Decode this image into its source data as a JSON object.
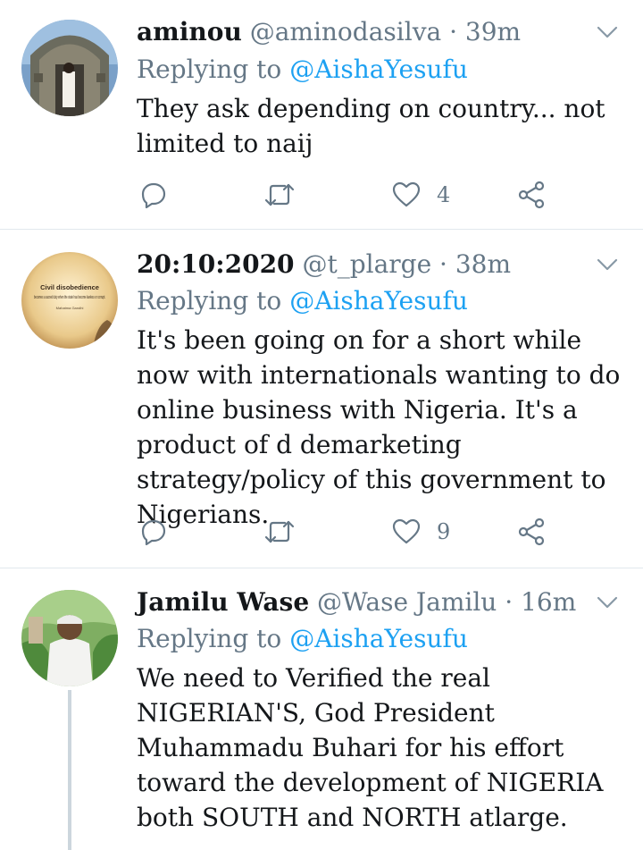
{
  "tweets": [
    {
      "name": "aminou",
      "handle": "@aminodasilva",
      "time": "39m",
      "replying_prefix": "Replying to",
      "replying_to": "@AishaYesufu",
      "text": "They ask depending on country... not limited to naij",
      "like_count": "4",
      "icons": [
        "reply-icon",
        "retweet-icon",
        "like-icon",
        "share-icon"
      ]
    },
    {
      "name": "20:10:2020",
      "handle": "@t_plarge",
      "time": "38m",
      "replying_prefix": "Replying to",
      "replying_to": "@AishaYesufu",
      "text": "It's been going on for a short while now with internationals wanting to do online business with Nigeria. It's a product of d demarketing strategy/policy of this government to Nigerians.",
      "like_count": "9",
      "avatar_text": {
        "title": "Civil disobedience",
        "lines": "becomes a sacred duty when the state has become lawless or corrupt.",
        "author": "Mahatma Gandhi"
      }
    },
    {
      "name": "Jamilu Wase",
      "handle": "@Wase Jamilu",
      "time": "16m",
      "replying_prefix": "Replying to",
      "replying_to": "@AishaYesufu",
      "text": "We need to Verified the real NIGERIAN'S, God President Muhammadu Buhari for his effort toward the development of NIGERIA both SOUTH and NORTH atlarge."
    }
  ],
  "separator": "·",
  "colors": {
    "link": "#1da1f2",
    "muted": "#657786",
    "divider": "#e1e8ed"
  }
}
